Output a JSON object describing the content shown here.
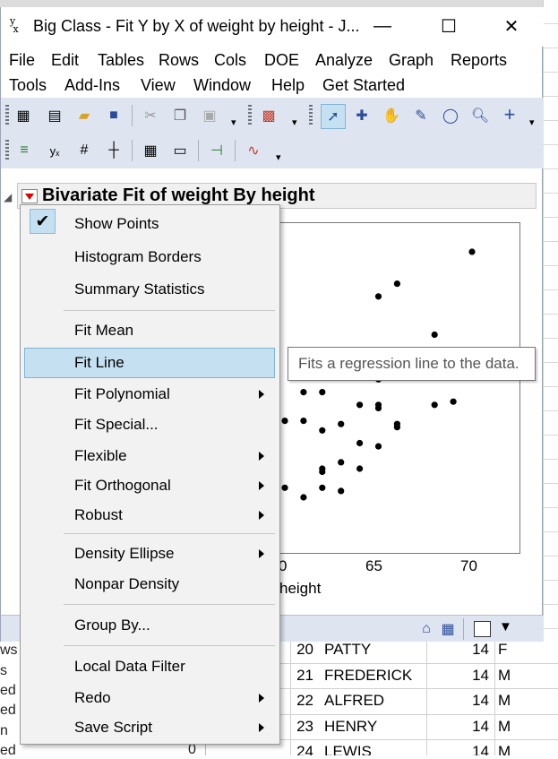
{
  "window": {
    "title": "Big Class - Fit Y by X of weight by height - J...",
    "minimize": "—",
    "maximize": "☐",
    "close": "✕"
  },
  "menubar": {
    "row1": [
      "File",
      "Edit",
      "Tables",
      "Rows",
      "Cols",
      "DOE",
      "Analyze",
      "Graph",
      "Reports"
    ],
    "row2": [
      "Tools",
      "Add-Ins",
      "View",
      "Window",
      "Help",
      "Get Started"
    ]
  },
  "report": {
    "title": "Bivariate Fit of weight By height"
  },
  "plot": {
    "x_ticks": [
      "0",
      "65",
      "70"
    ],
    "xlabel": "height"
  },
  "chart_data": {
    "type": "scatter",
    "xlabel": "height",
    "points": [
      [
        70,
        172
      ],
      [
        66,
        162
      ],
      [
        65,
        158
      ],
      [
        68,
        146
      ],
      [
        65,
        132
      ],
      [
        61,
        128
      ],
      [
        62,
        128
      ],
      [
        64,
        124
      ],
      [
        65,
        124
      ],
      [
        65,
        123
      ],
      [
        68,
        124
      ],
      [
        69,
        125
      ],
      [
        60,
        119
      ],
      [
        61,
        119
      ],
      [
        63,
        118
      ],
      [
        66,
        118
      ],
      [
        66,
        117
      ],
      [
        62,
        116
      ],
      [
        64,
        112
      ],
      [
        65,
        111
      ],
      [
        63,
        106
      ],
      [
        62,
        104
      ],
      [
        62,
        103
      ],
      [
        64,
        104
      ],
      [
        60,
        98
      ],
      [
        61,
        95
      ],
      [
        63,
        97
      ],
      [
        62,
        98
      ]
    ]
  },
  "popup_menu": {
    "items": [
      {
        "label": "Show Points",
        "checked": true
      },
      {
        "label": "Histogram Borders"
      },
      {
        "label": "Summary Statistics"
      },
      {
        "label": "Fit Mean"
      },
      {
        "label": "Fit Line",
        "highlighted": true
      },
      {
        "label": "Fit Polynomial",
        "submenu": true
      },
      {
        "label": "Fit Special..."
      },
      {
        "label": "Flexible",
        "submenu": true
      },
      {
        "label": "Fit Orthogonal",
        "submenu": true
      },
      {
        "label": "Robust",
        "submenu": true
      },
      {
        "label": "Density Ellipse",
        "submenu": true
      },
      {
        "label": "Nonpar Density"
      },
      {
        "label": "Group By..."
      },
      {
        "label": "Local Data Filter"
      },
      {
        "label": "Redo",
        "submenu": true
      },
      {
        "label": "Save Script",
        "submenu": true
      }
    ]
  },
  "tooltip": "Fits a regression line to the data.",
  "background_table": {
    "left_labels": [
      "ws",
      "s",
      "ed",
      "ed",
      "n",
      "ed"
    ],
    "left_zero": "0",
    "rows": [
      {
        "num": "20",
        "name": "PATTY",
        "age": "14",
        "sex": "F"
      },
      {
        "num": "21",
        "name": "FREDERICK",
        "age": "14",
        "sex": "M"
      },
      {
        "num": "22",
        "name": "ALFRED",
        "age": "14",
        "sex": "M"
      },
      {
        "num": "23",
        "name": "HENRY",
        "age": "14",
        "sex": "M"
      },
      {
        "num": "24",
        "name": "LEWIS",
        "age": "14",
        "sex": "M"
      }
    ]
  },
  "icons": {
    "app": "jmp-fit-icon",
    "home": "home-icon",
    "table": "data-table-icon",
    "dropdown": "dropdown-arrow-icon"
  }
}
